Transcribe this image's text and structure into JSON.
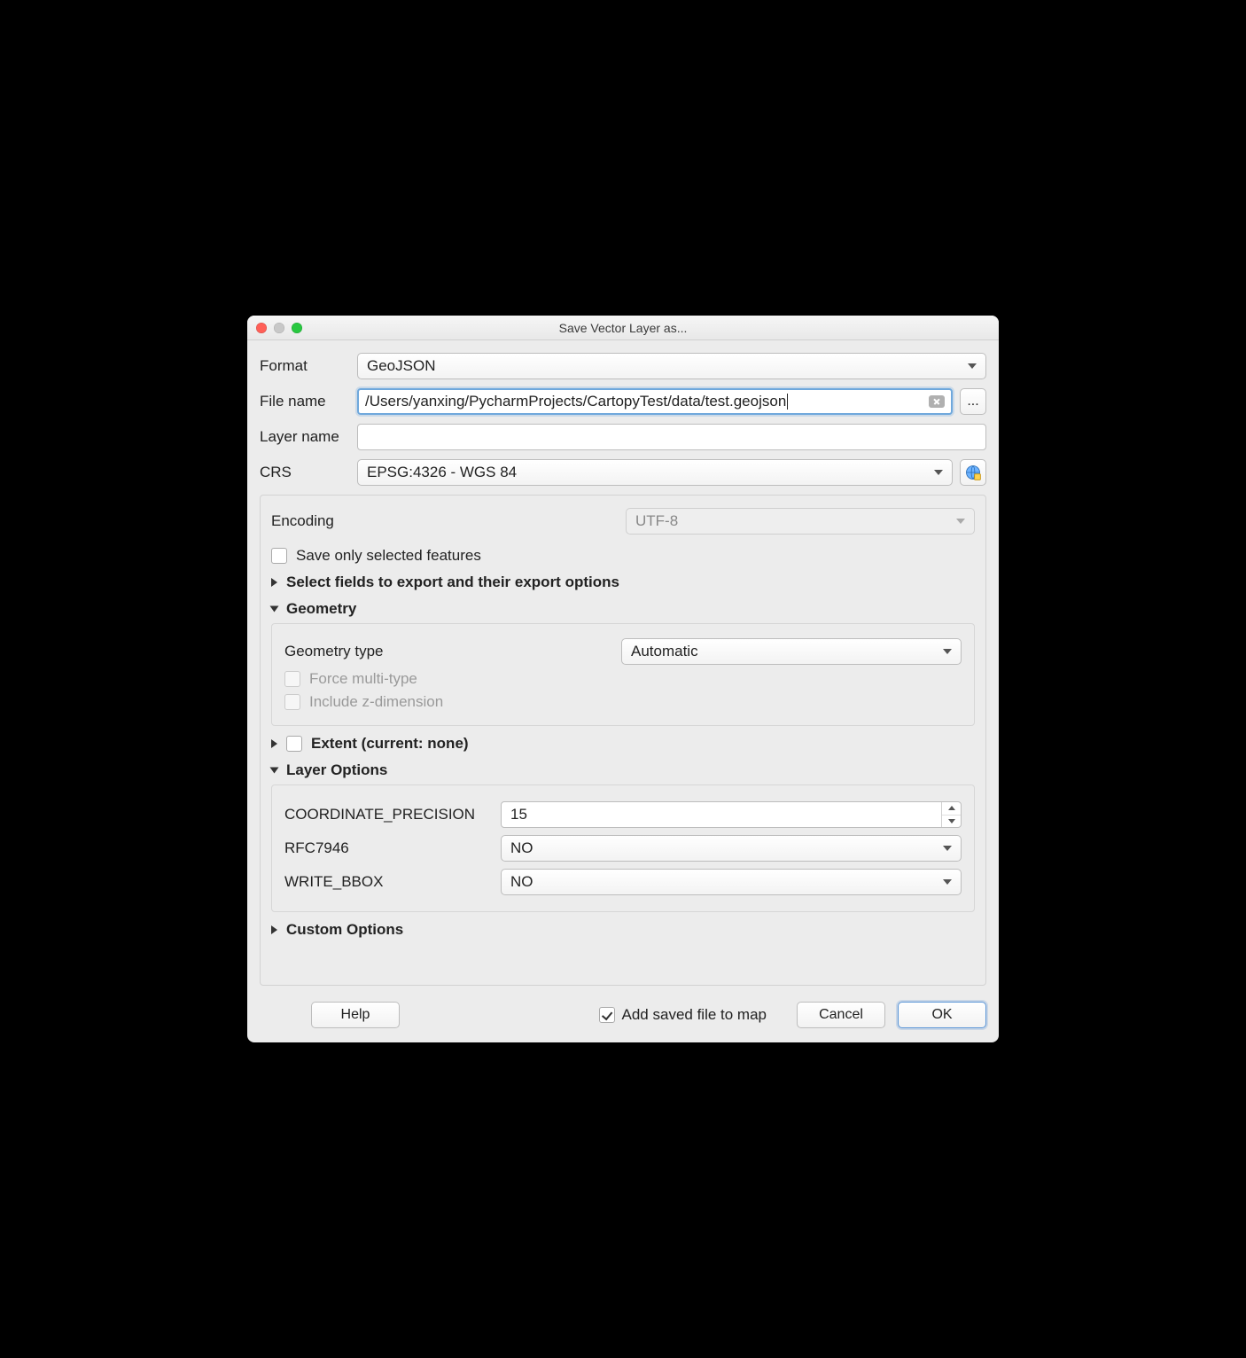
{
  "window": {
    "title": "Save Vector Layer as..."
  },
  "labels": {
    "format": "Format",
    "file_name": "File name",
    "layer_name": "Layer name",
    "crs": "CRS",
    "encoding": "Encoding",
    "save_only_selected": "Save only selected features",
    "select_fields": "Select fields to export and their export options",
    "geometry": "Geometry",
    "geometry_type": "Geometry type",
    "force_multi": "Force multi-type",
    "include_z": "Include z-dimension",
    "extent": "Extent (current: none)",
    "layer_options": "Layer Options",
    "coord_precision": "COORDINATE_PRECISION",
    "rfc7946": "RFC7946",
    "write_bbox": "WRITE_BBOX",
    "custom_options": "Custom Options",
    "add_saved": "Add saved file to map"
  },
  "values": {
    "format": "GeoJSON",
    "file_name": "/Users/yanxing/PycharmProjects/CartopyTest/data/test.geojson",
    "layer_name": "",
    "crs": "EPSG:4326 - WGS 84",
    "encoding": "UTF-8",
    "geometry_type": "Automatic",
    "coord_precision": "15",
    "rfc7946": "NO",
    "write_bbox": "NO"
  },
  "buttons": {
    "browse": "...",
    "help": "Help",
    "cancel": "Cancel",
    "ok": "OK"
  },
  "icons": {
    "globe": "globe-icon"
  }
}
